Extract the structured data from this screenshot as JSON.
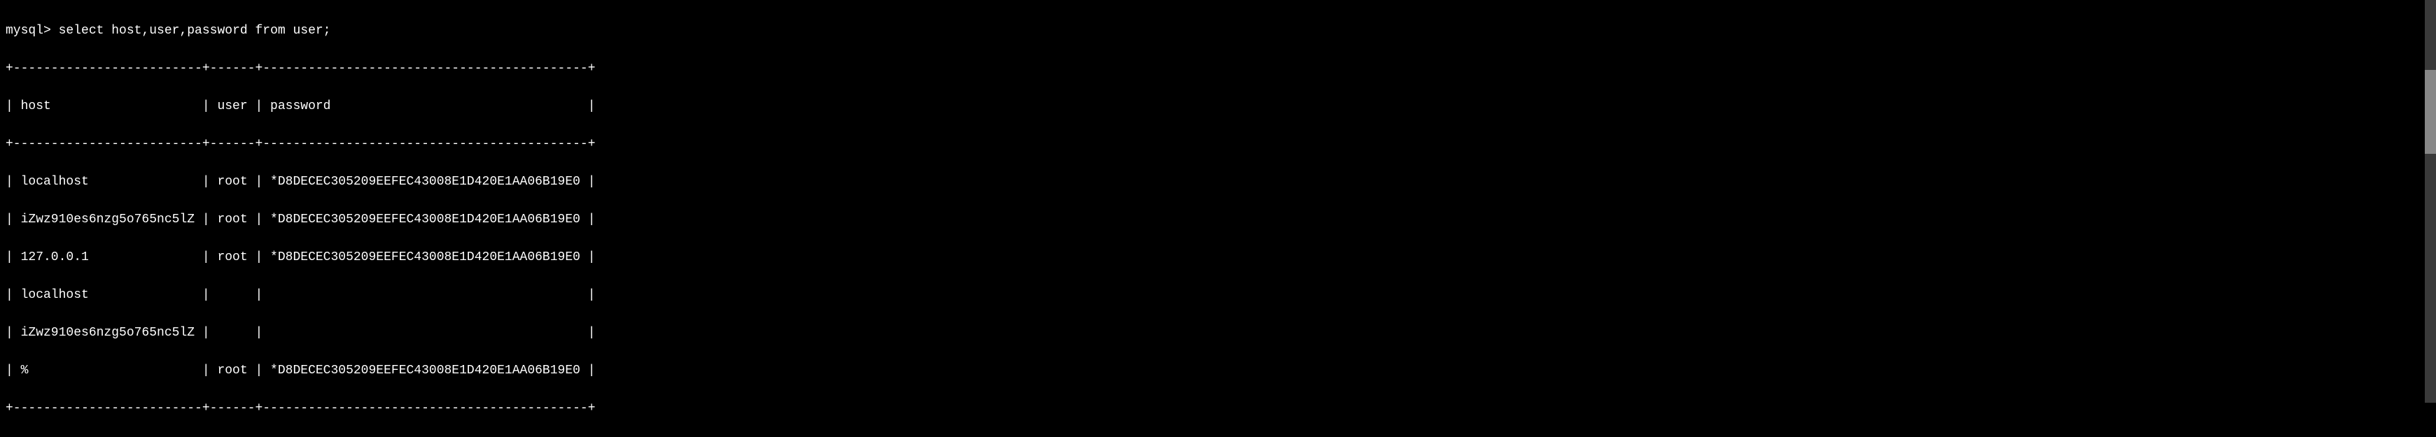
{
  "prompt": "mysql> ",
  "command": "select host,user,password from user;",
  "table": {
    "border_top": "+-------------------------+------+-------------------------------------------+",
    "header_line": "| host                    | user | password                                  |",
    "border_mid": "+-------------------------+------+-------------------------------------------+",
    "rows": [
      "| localhost               | root | *D8DECEC305209EEFEC43008E1D420E1AA06B19E0 |",
      "| iZwz910es6nzg5o765nc5lZ | root | *D8DECEC305209EEFEC43008E1D420E1AA06B19E0 |",
      "| 127.0.0.1               | root | *D8DECEC305209EEFEC43008E1D420E1AA06B19E0 |",
      "| localhost               |      |                                           |",
      "| iZwz910es6nzg5o765nc5lZ |      |                                           |",
      "| %                       | root | *D8DECEC305209EEFEC43008E1D420E1AA06B19E0 |"
    ],
    "border_bottom": "+-------------------------+------+-------------------------------------------+"
  },
  "chart_data": {
    "type": "table",
    "columns": [
      "host",
      "user",
      "password"
    ],
    "rows": [
      {
        "host": "localhost",
        "user": "root",
        "password": "*D8DECEC305209EEFEC43008E1D420E1AA06B19E0"
      },
      {
        "host": "iZwz910es6nzg5o765nc5lZ",
        "user": "root",
        "password": "*D8DECEC305209EEFEC43008E1D420E1AA06B19E0"
      },
      {
        "host": "127.0.0.1",
        "user": "root",
        "password": "*D8DECEC305209EEFEC43008E1D420E1AA06B19E0"
      },
      {
        "host": "localhost",
        "user": "",
        "password": ""
      },
      {
        "host": "iZwz910es6nzg5o765nc5lZ",
        "user": "",
        "password": ""
      },
      {
        "host": "%",
        "user": "root",
        "password": "*D8DECEC305209EEFEC43008E1D420E1AA06B19E0"
      }
    ]
  }
}
